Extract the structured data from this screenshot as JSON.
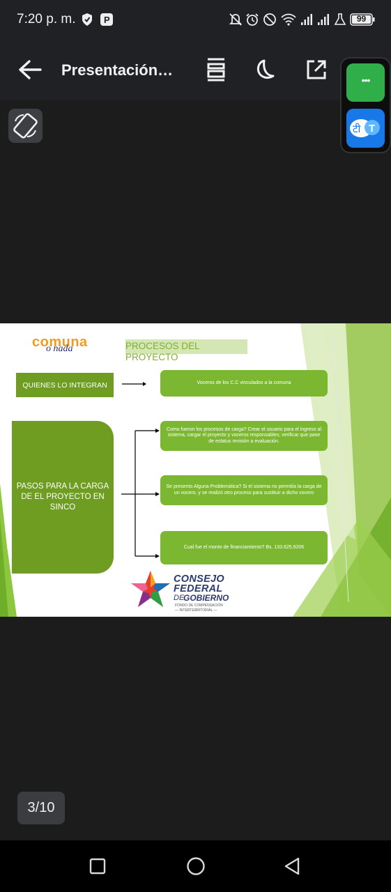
{
  "status_bar": {
    "time": "7:20 p. m.",
    "battery": "99",
    "icons": [
      "shield-icon",
      "p-app-icon",
      "mute-icon",
      "alarm-icon",
      "dnd-icon",
      "wifi-icon",
      "signal-icon",
      "signal-icon-2",
      "flask-icon",
      "battery-icon"
    ]
  },
  "app_bar": {
    "title": "Presentación…",
    "icons": [
      "back-arrow-icon",
      "layout-icon",
      "night-mode-icon",
      "open-external-icon"
    ]
  },
  "floating": {
    "more_label": "•••",
    "translate_label": "टी"
  },
  "slide": {
    "logo_top": "comuna",
    "logo_bottom": "o nada",
    "title": "PROCESOS DEL PROYECTO",
    "quienes_label": "QUIENES LO INTEGRAN",
    "quienes_answer": "Voceros de los C.C vinculados a la comuna",
    "pasos_label": "PASOS PARA LA CARGA DE EL PROYECTO  EN SINCO",
    "step1": "Como fueron los procesos de carga? Crear el usuario para el ingreso al sistema, cargar el proyecto y voceros responsables; verificar que pase de estatus revisión a evaluación.",
    "step2": "Se presento Alguna Problemática? Si el sistema no permitía la carga de un vocero, y se realizó otro proceso  para sustituir a dicho vocero",
    "step3": "Cual fue el monto de financiamiento? Bs. 133.625,9206",
    "consejo_line1": "CONSEJO",
    "consejo_line2": "FEDERAL",
    "consejo_line3a": "DE",
    "consejo_line3b": "GOBIERNO",
    "consejo_sub1": "FONDO DE COMPENSACIÓN",
    "consejo_sub2": "— INTERTERRITORIAL —"
  },
  "pager": {
    "label": "3/10"
  },
  "nav_bar": {
    "icons": [
      "recents-square-icon",
      "home-circle-icon",
      "back-triangle-icon"
    ]
  },
  "colors": {
    "accent_green": "#7cb732",
    "dark_green": "#6e9d22",
    "background": "#202124"
  }
}
